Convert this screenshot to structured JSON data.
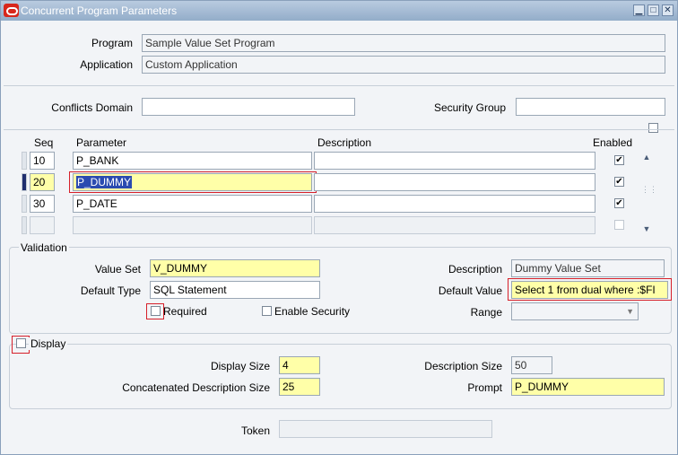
{
  "window": {
    "title": "Concurrent Program Parameters"
  },
  "header": {
    "program_label": "Program",
    "program_value": "Sample Value Set  Program",
    "application_label": "Application",
    "application_value": "Custom Application",
    "conflicts_label": "Conflicts Domain",
    "conflicts_value": "",
    "security_label": "Security Group",
    "security_value": ""
  },
  "grid": {
    "columns": {
      "seq": "Seq",
      "parameter": "Parameter",
      "description": "Description",
      "enabled": "Enabled"
    },
    "rows": [
      {
        "seq": "10",
        "parameter": "P_BANK",
        "description": "",
        "enabled": true
      },
      {
        "seq": "20",
        "parameter": "P_DUMMY",
        "description": "",
        "enabled": true
      },
      {
        "seq": "30",
        "parameter": "P_DATE",
        "description": "",
        "enabled": true
      },
      {
        "seq": "",
        "parameter": "",
        "description": "",
        "enabled": false
      }
    ]
  },
  "validation": {
    "section_label": "Validation",
    "value_set_label": "Value Set",
    "value_set_value": "V_DUMMY",
    "default_type_label": "Default Type",
    "default_type_value": "SQL Statement",
    "required_label": "Required",
    "enable_security_label": "Enable Security",
    "description_label": "Description",
    "description_value": "Dummy Value Set",
    "default_value_label": "Default Value",
    "default_value_value": "Select 1 from dual where :$FI",
    "range_label": "Range",
    "range_value": ""
  },
  "display": {
    "section_label": "Display",
    "display_size_label": "Display Size",
    "display_size_value": "4",
    "concat_size_label": "Concatenated Description Size",
    "concat_size_value": "25",
    "desc_size_label": "Description Size",
    "desc_size_value": "50",
    "prompt_label": "Prompt",
    "prompt_value": "P_DUMMY"
  },
  "token": {
    "label": "Token",
    "value": ""
  },
  "colors": {
    "highlight": "#d6202a",
    "required_fill": "#ffffa8",
    "title_bar": "#a8bdd6"
  }
}
